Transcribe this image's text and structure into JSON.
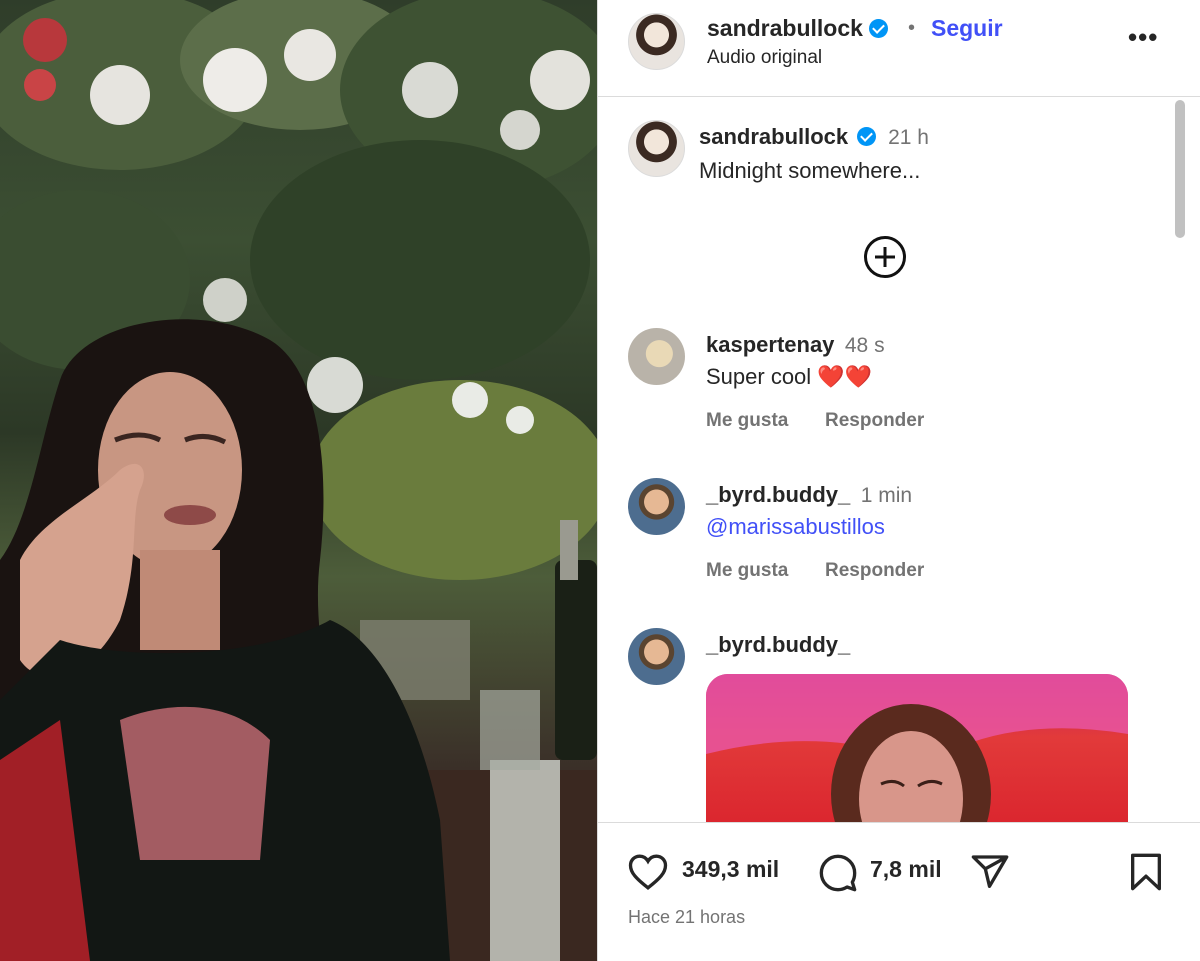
{
  "media": {
    "description_icon": "video-frame"
  },
  "header": {
    "username": "sandrabullock",
    "separator": "•",
    "follow_label": "Seguir",
    "audio_label": "Audio original",
    "more_icon": "more-icon",
    "more_glyph": "•••"
  },
  "caption": {
    "username": "sandrabullock",
    "time": "21 h",
    "text": "Midnight somewhere..."
  },
  "comments": [
    {
      "username": "kaspertenay",
      "time": "48 s",
      "text": "Super cool ❤️❤️",
      "like_label": "Me gusta",
      "reply_label": "Responder"
    },
    {
      "username": "_byrd.buddy_",
      "time": "1 min",
      "text": "@marissabustillos",
      "like_label": "Me gusta",
      "reply_label": "Responder"
    },
    {
      "username": "_byrd.buddy_"
    }
  ],
  "footer": {
    "likes": "349,3 mil",
    "comments": "7,8 mil",
    "posted": "Hace 21 horas"
  },
  "colors": {
    "link": "#4150f7",
    "verified": "#0095f6",
    "muted": "#737373"
  }
}
